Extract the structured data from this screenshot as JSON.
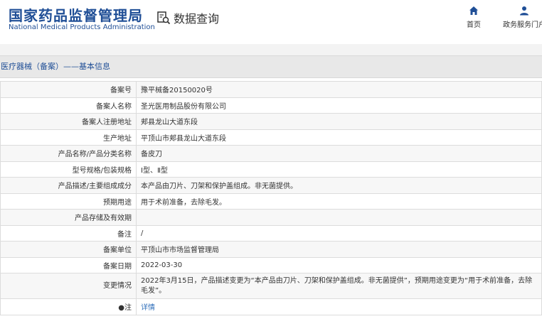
{
  "header": {
    "logo_cn": "国家药品监督管理局",
    "logo_en": "National Medical Products Administration",
    "search_title": "数据查询",
    "nav": [
      {
        "label": "首页",
        "icon": "home-icon"
      },
      {
        "label": "政务服务门户",
        "icon": "user-icon"
      }
    ]
  },
  "section_title": "医疗器械（备案）——基本信息",
  "rows": [
    {
      "label": "备案号",
      "value": "豫平械备20150020号"
    },
    {
      "label": "备案人名称",
      "value": "圣光医用制品股份有限公司"
    },
    {
      "label": "备案人注册地址",
      "value": "郏县龙山大道东段"
    },
    {
      "label": "生产地址",
      "value": "平顶山市郏县龙山大道东段"
    },
    {
      "label": "产品名称/产品分类名称",
      "value": "备皮刀"
    },
    {
      "label": "型号规格/包装规格",
      "value": "Ⅰ型、Ⅱ型"
    },
    {
      "label": "产品描述/主要组成成分",
      "value": "本产品由刀片、刀架和保护盖组成。非无菌提供。"
    },
    {
      "label": "预期用途",
      "value": "用于术前准备，去除毛发。"
    },
    {
      "label": "产品存储及有效期",
      "value": ""
    },
    {
      "label": "备注",
      "value": "/"
    },
    {
      "label": "备案单位",
      "value": "平顶山市市场监督管理局"
    },
    {
      "label": "备案日期",
      "value": "2022-03-30"
    },
    {
      "label": "变更情况",
      "value": "2022年3月15日，产品描述变更为“本产品由刀片、刀架和保护盖组成。非无菌提供”，预期用途变更为“用于术前准备，去除毛发”。"
    },
    {
      "label": "●注",
      "value": "详情"
    }
  ],
  "colors": {
    "brand": "#1f4e96",
    "link": "#2f6fba"
  }
}
